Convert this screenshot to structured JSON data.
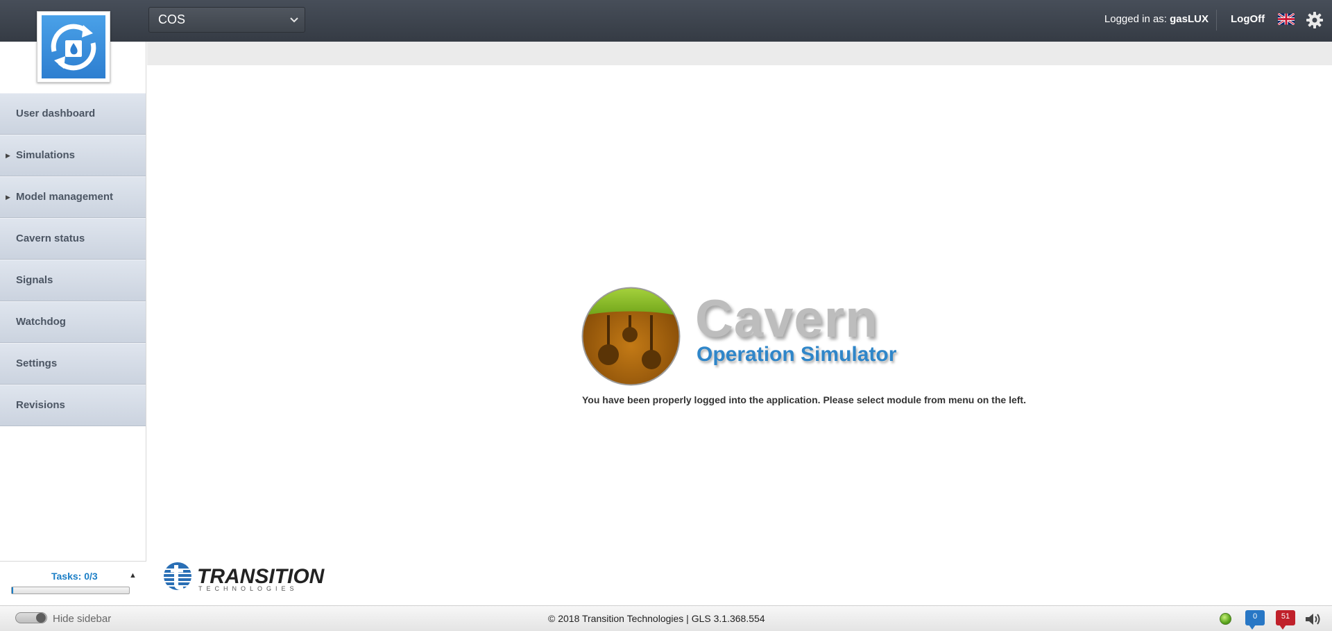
{
  "header": {
    "module_select": "COS",
    "logged_in_label": "Logged in as:",
    "username": "gasLUX",
    "logoff_label": "LogOff"
  },
  "sidebar": {
    "items": [
      {
        "label": "User dashboard",
        "expandable": false
      },
      {
        "label": "Simulations",
        "expandable": true
      },
      {
        "label": "Model management",
        "expandable": true
      },
      {
        "label": "Cavern status",
        "expandable": false
      },
      {
        "label": "Signals",
        "expandable": false
      },
      {
        "label": "Watchdog",
        "expandable": false
      },
      {
        "label": "Settings",
        "expandable": false
      },
      {
        "label": "Revisions",
        "expandable": false
      }
    ],
    "tasks_label": "Tasks: 0/3",
    "tasks_progress": 0.0
  },
  "main": {
    "splash_title": "Cavern",
    "splash_subtitle": "Operation Simulator",
    "welcome_message": "You have been properly logged into the application. Please select module from menu on the left.",
    "vendor_name": "TRANSITION",
    "vendor_sub": "TECHNOLOGIES"
  },
  "footer": {
    "hide_sidebar_label": "Hide sidebar",
    "copyright": "© 2018 Transition Technologies | GLS 3.1.368.554",
    "messages_count": "0",
    "alerts_count": "51"
  },
  "colors": {
    "accent_blue": "#1b7ec6",
    "header_bg": "#3d434c",
    "alert_red": "#c0212b",
    "status_green": "#5aa51d"
  },
  "icons": {
    "app_logo": "gas-cycle-icon",
    "language": "uk-flag-icon",
    "settings": "gear-icon",
    "status": "status-ok-icon",
    "messages": "speech-bubble-icon",
    "alerts": "alert-bubble-icon",
    "sound": "speaker-icon"
  }
}
